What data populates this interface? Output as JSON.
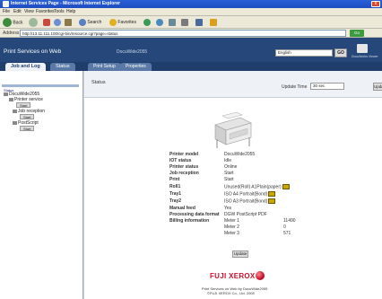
{
  "window": {
    "title": "Internet Services Page - Microsoft Internet Explorer",
    "close": "x"
  },
  "menubar": {
    "items": [
      "File",
      "Edit",
      "View",
      "Favorites",
      "Tools",
      "Help"
    ]
  },
  "toolbar": {
    "back_label": "Back",
    "search_label": "Search",
    "favorites_label": "Favorites"
  },
  "address": {
    "label": "Address",
    "value": "http://13.11.111.100/cgi-bin/resource.cgi?page=status",
    "go_label": "Go"
  },
  "header": {
    "app_title": "Print Services on Web",
    "device_name": "DocuWide2055",
    "language_value": "English",
    "go_label": "GO",
    "icon_label": "DocuWorks Viewer"
  },
  "tabs": {
    "main": [
      "Job and Log",
      "Status"
    ],
    "sub": [
      "Print Setup",
      "Properties"
    ]
  },
  "tree": {
    "section_label": "Status",
    "root": "DocuWide2055",
    "printer_service": "Printer service",
    "start_button": "Start",
    "job_reception": "Job reception",
    "job_start_button": "Start",
    "postscript": "PostScript",
    "ps_start_button": "Start"
  },
  "status": {
    "title": "Status",
    "update_label": "Update Time",
    "update_interval": "30 sec",
    "update_button": "Update",
    "update_bottom_button": "Update"
  },
  "info": [
    {
      "label": "Printer model",
      "value": "DocuWide2055"
    },
    {
      "label": "IOT status",
      "value": "Idle"
    },
    {
      "label": "Printer status",
      "value": "Online"
    },
    {
      "label": "Job reception",
      "value": "Start"
    },
    {
      "label": "Print",
      "value": "Start"
    },
    {
      "label": "Roll1",
      "value": "Unused(Roll) A1Plain(paper)"
    },
    {
      "label": "Tray1",
      "value": "ISO A4 Portrait(Bond)"
    },
    {
      "label": "Tray2",
      "value": "ISO A3 Portrait(Bond)"
    },
    {
      "label": "Manual feed",
      "value": "Yes"
    },
    {
      "label": "Processing data format",
      "value": "DGW PostScript PDF"
    },
    {
      "label": "Billing information",
      "value": ""
    }
  ],
  "billing": [
    {
      "meter": "Meter 1",
      "count": "11490"
    },
    {
      "meter": "Meter 2",
      "count": "0"
    },
    {
      "meter": "Meter 3",
      "count": "571"
    }
  ],
  "footer": {
    "logo": "FUJI XEROX",
    "line1": "Print Services on Web by DocuWide2055",
    "line2": "©FUJI XEROX Co., Ltd. 2005"
  }
}
